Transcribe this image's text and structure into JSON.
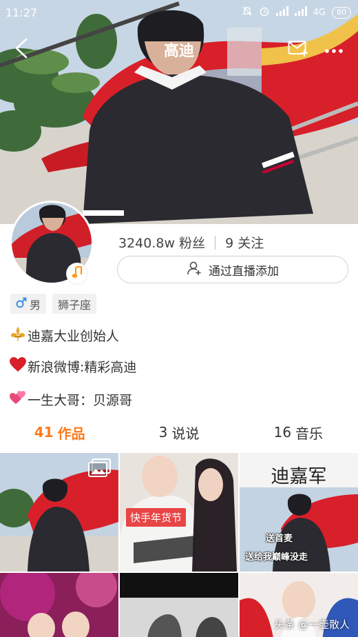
{
  "status_bar": {
    "time": "11:27",
    "network": "4G",
    "battery": "80"
  },
  "header": {
    "title": "高迪"
  },
  "profile": {
    "followers": "3240.8w 粉丝",
    "following": "9 关注",
    "live_add_label": "通过直播添加"
  },
  "tags": [
    {
      "icon": "male-icon",
      "label": "男"
    },
    {
      "label": "狮子座"
    }
  ],
  "bio": [
    {
      "icon": "fleur-de-lis-icon",
      "text": "迪嘉大业创始人"
    },
    {
      "icon": "heart-icon",
      "text": "新浪微博:精彩高迪"
    },
    {
      "icon": "double-heart-icon",
      "text": "一生大哥：贝源哥"
    }
  ],
  "tabs": [
    {
      "count": "41",
      "label": "作品",
      "active": true
    },
    {
      "count": "3",
      "label": "说说",
      "active": false
    },
    {
      "count": "16",
      "label": "音乐",
      "active": false
    }
  ],
  "grid": {
    "badge": "快手年货节",
    "title": "迪嘉军",
    "caption_1": "送首麦",
    "caption_2": "送给我巅峰没走"
  },
  "watermark": "头条 @一壶散人",
  "colors": {
    "accent": "#ff7a1a",
    "badge": "#e84545",
    "helicopter": "#d8202a"
  }
}
